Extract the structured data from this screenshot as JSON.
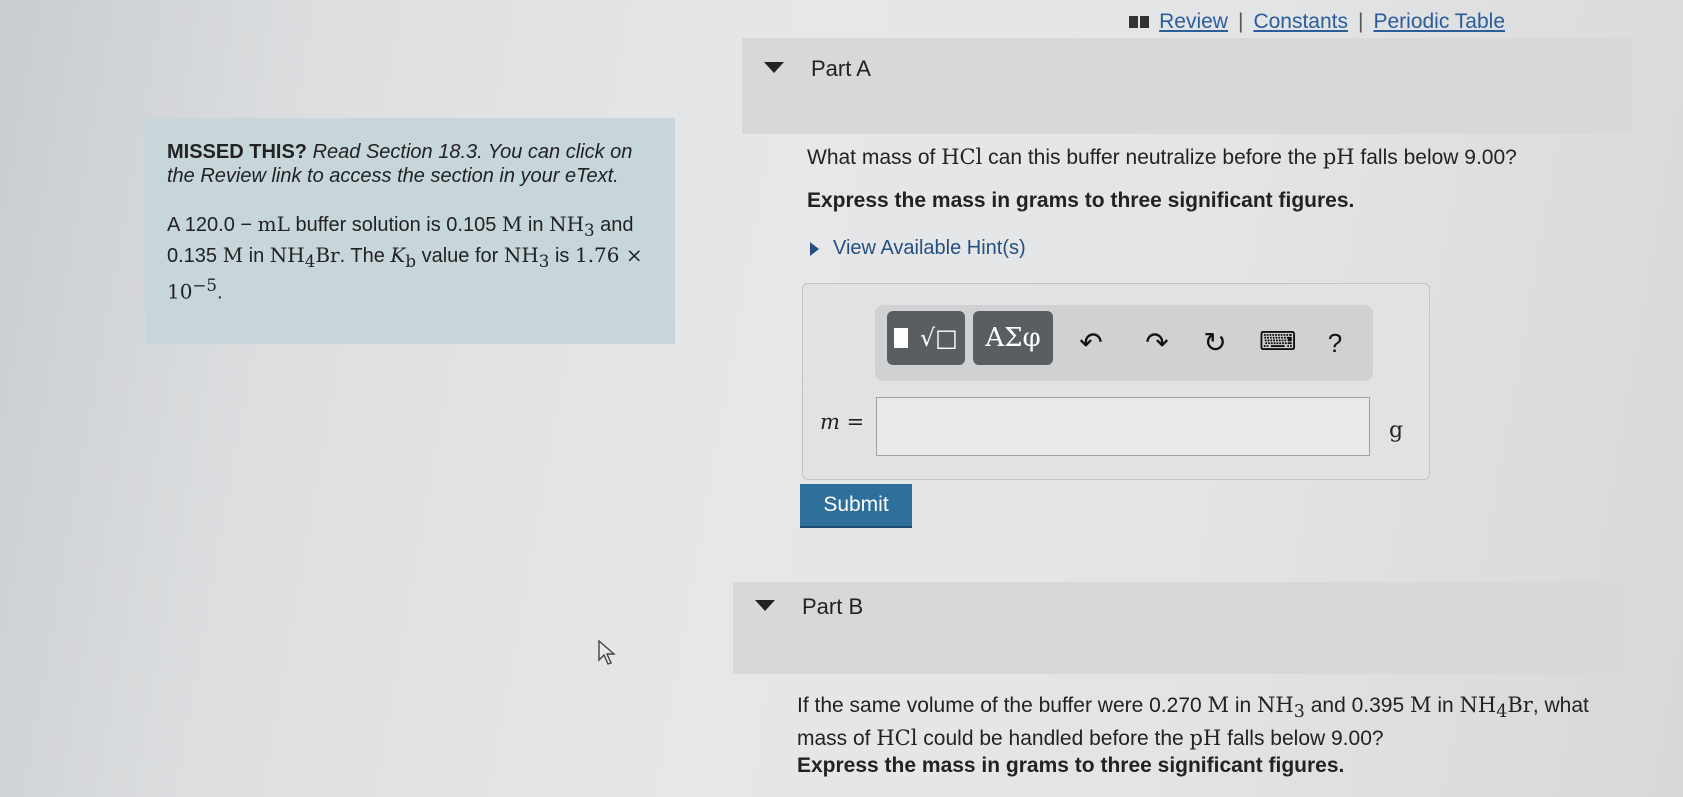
{
  "header": {
    "links": [
      "Review",
      "Constants",
      "Periodic Table"
    ],
    "separator": "|"
  },
  "info": {
    "missed_bold": "MISSED THIS?",
    "missed_text": " Read Section 18.3. You can click on the Review link to access the section in your eText.",
    "problem": {
      "p1": "A 120.0 − ",
      "mL": "mL",
      "p2": " buffer solution is 0.105 ",
      "M1": "M",
      "p3": " in ",
      "NH3a": "NH",
      "sub3a": "3",
      "p4": " and 0.135 ",
      "M2": "M",
      "p5": " in ",
      "NH4": "NH",
      "sub4": "4",
      "Br": "Br",
      "p6": ". The ",
      "K": "K",
      "subb": "b",
      "p7": " value for ",
      "NH3b": "NH",
      "sub3b": "3",
      "p8": " is ",
      "val": "1.76 × 10",
      "exp": "−5",
      "p9": "."
    }
  },
  "partA": {
    "title": "Part A",
    "q1": "What mass of ",
    "q_HCl": "HCl",
    "q2": " can this buffer neutralize before the ",
    "q_pH": "pH",
    "q3": " falls below 9.00?",
    "instruction": "Express the mass in grams to three significant figures.",
    "hint_label": "View Available Hint(s)",
    "toolbar": {
      "templates_label": " √□",
      "greek_label": "ΑΣφ",
      "undo": "↶",
      "redo": "↷",
      "reset": "↻",
      "keyboard": "⌨",
      "help": "?"
    },
    "answer_label": "m =",
    "answer_value": "",
    "unit": "g",
    "submit_label": "Submit"
  },
  "partB": {
    "title": "Part B",
    "q1": "If the same volume of the buffer were 0.270 ",
    "M1": "M",
    "q2": " in ",
    "NH3": "NH",
    "sub3": "3",
    "q3": " and 0.395 ",
    "M2": "M",
    "q4": " in ",
    "NH4": "NH",
    "sub4": "4",
    "Br": "Br",
    "q5": ", what mass of ",
    "HCl": "HCl",
    "q6": " could be handled before the ",
    "pH": "pH",
    "q7": " falls below 9.00?",
    "instruction": "Express the mass in grams to three significant figures."
  },
  "colors": {
    "link": "#2a5d9a",
    "info_bg": "#c7d6db",
    "submit_bg": "#2f6f9c",
    "toolbar_btn": "#5a5e63"
  }
}
